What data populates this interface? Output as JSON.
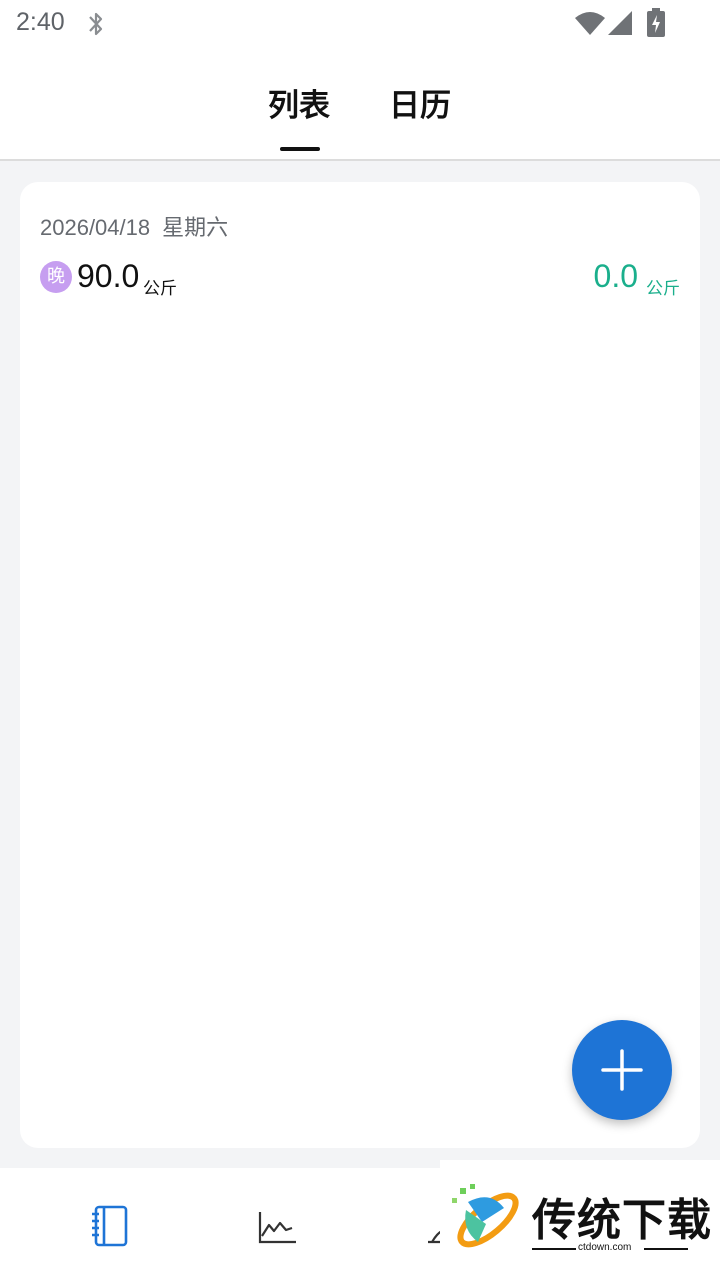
{
  "status_bar": {
    "time": "2:40",
    "icons": [
      "bluetooth-icon",
      "wifi-icon",
      "signal-icon",
      "battery-charging-icon"
    ]
  },
  "tabs": [
    {
      "label": "列表",
      "active": true
    },
    {
      "label": "日历",
      "active": false
    }
  ],
  "record": {
    "date": "2026/04/18",
    "weekday": "星期六",
    "period_badge": "晚",
    "weight": "90.0",
    "weight_unit": "公斤",
    "change": "0.0",
    "change_unit": "公斤"
  },
  "fab": {
    "icon": "plus-icon"
  },
  "bottom_nav": [
    {
      "icon": "notebook-icon",
      "active": true
    },
    {
      "icon": "trend-chart-icon",
      "active": false
    },
    {
      "icon": "scale-icon",
      "active": false
    }
  ],
  "watermark": {
    "title": "传统下载",
    "url": "ctdown.com"
  },
  "colors": {
    "accent": "#1e74d6",
    "change_green": "#1aaf8c",
    "badge_purple": "#c69ef0",
    "background": "#f3f4f6"
  }
}
